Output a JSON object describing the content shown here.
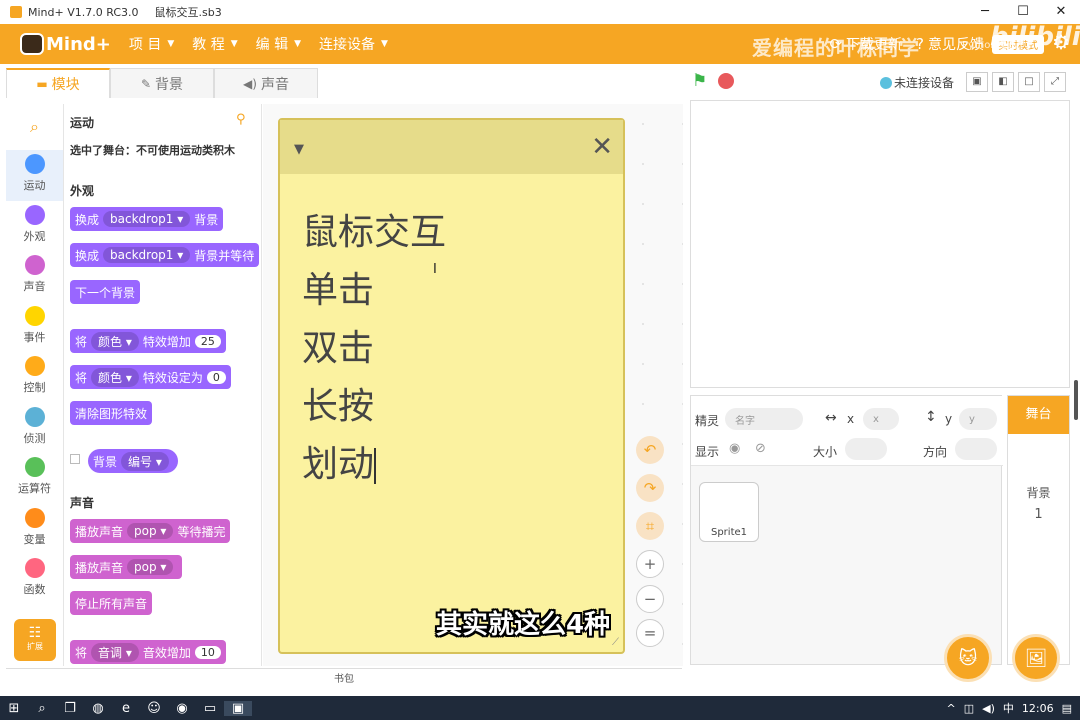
{
  "window": {
    "title": "Mind+ V1.7.0 RC3.0",
    "file": "鼠标交互.sb3"
  },
  "menu": {
    "logo": "Mind+",
    "items": [
      "项 目",
      "教 程",
      "编 辑",
      "连接设备"
    ],
    "download": "下载更新",
    "feedback": "意见反馈",
    "mode": "实时模式",
    "watermark": "爱编程的叶栋同学",
    "wm_small": "Python模式",
    "bili": "bilibili"
  },
  "tabs": [
    {
      "label": "模块",
      "icon": "puzzle-icon"
    },
    {
      "label": "背景",
      "icon": "brush-icon"
    },
    {
      "label": "声音",
      "icon": "speaker-icon"
    }
  ],
  "device_status": "未连接设备",
  "categories": [
    {
      "label": "运动",
      "color": "#4c97ff"
    },
    {
      "label": "外观",
      "color": "#9966ff"
    },
    {
      "label": "声音",
      "color": "#cf63cf"
    },
    {
      "label": "事件",
      "color": "#ffd500"
    },
    {
      "label": "控制",
      "color": "#ffab19"
    },
    {
      "label": "侦测",
      "color": "#5cb1d6"
    },
    {
      "label": "运算符",
      "color": "#59c059"
    },
    {
      "label": "变量",
      "color": "#ff8c1a"
    },
    {
      "label": "函数",
      "color": "#ff6680"
    }
  ],
  "extension_label": "扩展",
  "palette": {
    "motion_title": "运动",
    "motion_note": "选中了舞台：不可使用运动类积木",
    "looks_title": "外观",
    "sound_title": "声音",
    "blocks": {
      "switch1_a": "换成",
      "switch1_drop": "backdrop1",
      "switch1_b": "背景",
      "switch2_a": "换成",
      "switch2_drop": "backdrop1",
      "switch2_b": "背景并等待",
      "next": "下一个背景",
      "eff1_a": "将",
      "eff1_drop": "颜色",
      "eff1_b": "特效增加",
      "eff1_num": "25",
      "eff2_a": "将",
      "eff2_drop": "颜色",
      "eff2_b": "特效设定为",
      "eff2_num": "0",
      "clear": "清除图形特效",
      "rep_a": "背景",
      "rep_drop": "编号",
      "play_a": "播放声音",
      "play_drop": "pop",
      "play_b": "等待播完",
      "start_a": "播放声音",
      "start_drop": "pop",
      "stopall": "停止所有声音",
      "pitch_a": "将",
      "pitch_drop": "音调",
      "pitch_b": "音效增加",
      "pitch_num": "10"
    }
  },
  "note": {
    "lines": [
      "鼠标交互",
      "单击",
      "双击",
      "长按",
      "划动"
    ]
  },
  "subtitle": "其实就这么4种",
  "sprite_info": {
    "sprite_label": "精灵",
    "name_placeholder": "名字",
    "x_label": "x",
    "x_placeholder": "x",
    "y_label": "y",
    "y_placeholder": "y",
    "show_label": "显示",
    "size_label": "大小",
    "dir_label": "方向"
  },
  "sprites": [
    {
      "name": "Sprite1"
    }
  ],
  "stage_panel": {
    "tab": "舞台",
    "backdrop_label": "背景",
    "backdrop_count": "1"
  },
  "backpack": "书包",
  "taskbar": {
    "time": "12:06",
    "ime": "中"
  }
}
